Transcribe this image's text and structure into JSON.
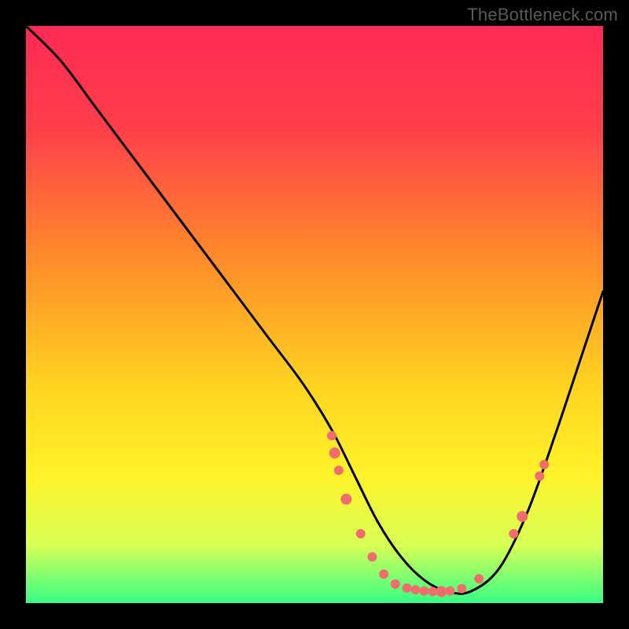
{
  "attribution": "TheBottleneck.com",
  "chart_data": {
    "type": "line",
    "title": "",
    "xlabel": "",
    "ylabel": "",
    "xlim": [
      0,
      100
    ],
    "ylim": [
      0,
      100
    ],
    "gradient_stops": [
      {
        "offset": 0,
        "color": "#ff2a55"
      },
      {
        "offset": 18,
        "color": "#ff3f4a"
      },
      {
        "offset": 40,
        "color": "#ff8a2a"
      },
      {
        "offset": 62,
        "color": "#ffd321"
      },
      {
        "offset": 78,
        "color": "#fff32a"
      },
      {
        "offset": 90,
        "color": "#d7ff55"
      },
      {
        "offset": 100,
        "color": "#37ff87"
      }
    ],
    "series": [
      {
        "name": "bottleneck-curve",
        "x": [
          0,
          6,
          12,
          18,
          24,
          30,
          36,
          42,
          48,
          53,
          57,
          61,
          65,
          69,
          73,
          77,
          82,
          87,
          92,
          96,
          100
        ],
        "y": [
          100,
          94,
          86,
          78,
          70,
          62,
          54,
          46,
          38,
          30,
          22,
          14,
          8,
          4,
          2,
          2,
          6,
          16,
          30,
          42,
          54
        ]
      }
    ],
    "markers": [
      {
        "x": 53.0,
        "y": 29,
        "r": 6
      },
      {
        "x": 53.5,
        "y": 26,
        "r": 7
      },
      {
        "x": 54.2,
        "y": 23,
        "r": 6
      },
      {
        "x": 55.5,
        "y": 18,
        "r": 7
      },
      {
        "x": 58.0,
        "y": 12,
        "r": 6
      },
      {
        "x": 60.0,
        "y": 8,
        "r": 6
      },
      {
        "x": 62.0,
        "y": 5,
        "r": 6
      },
      {
        "x": 64.0,
        "y": 3.3,
        "r": 6
      },
      {
        "x": 66.0,
        "y": 2.6,
        "r": 6
      },
      {
        "x": 67.5,
        "y": 2.3,
        "r": 6
      },
      {
        "x": 69.0,
        "y": 2.1,
        "r": 6
      },
      {
        "x": 70.5,
        "y": 2.0,
        "r": 6
      },
      {
        "x": 72.0,
        "y": 2.0,
        "r": 7
      },
      {
        "x": 73.5,
        "y": 2.1,
        "r": 6
      },
      {
        "x": 75.5,
        "y": 2.5,
        "r": 6
      },
      {
        "x": 78.5,
        "y": 4.2,
        "r": 6
      },
      {
        "x": 84.5,
        "y": 12.0,
        "r": 6
      },
      {
        "x": 86.0,
        "y": 15.0,
        "r": 7
      },
      {
        "x": 89.0,
        "y": 22.0,
        "r": 6
      },
      {
        "x": 89.8,
        "y": 24.0,
        "r": 6
      }
    ],
    "marker_color": "#ee6e6e"
  }
}
